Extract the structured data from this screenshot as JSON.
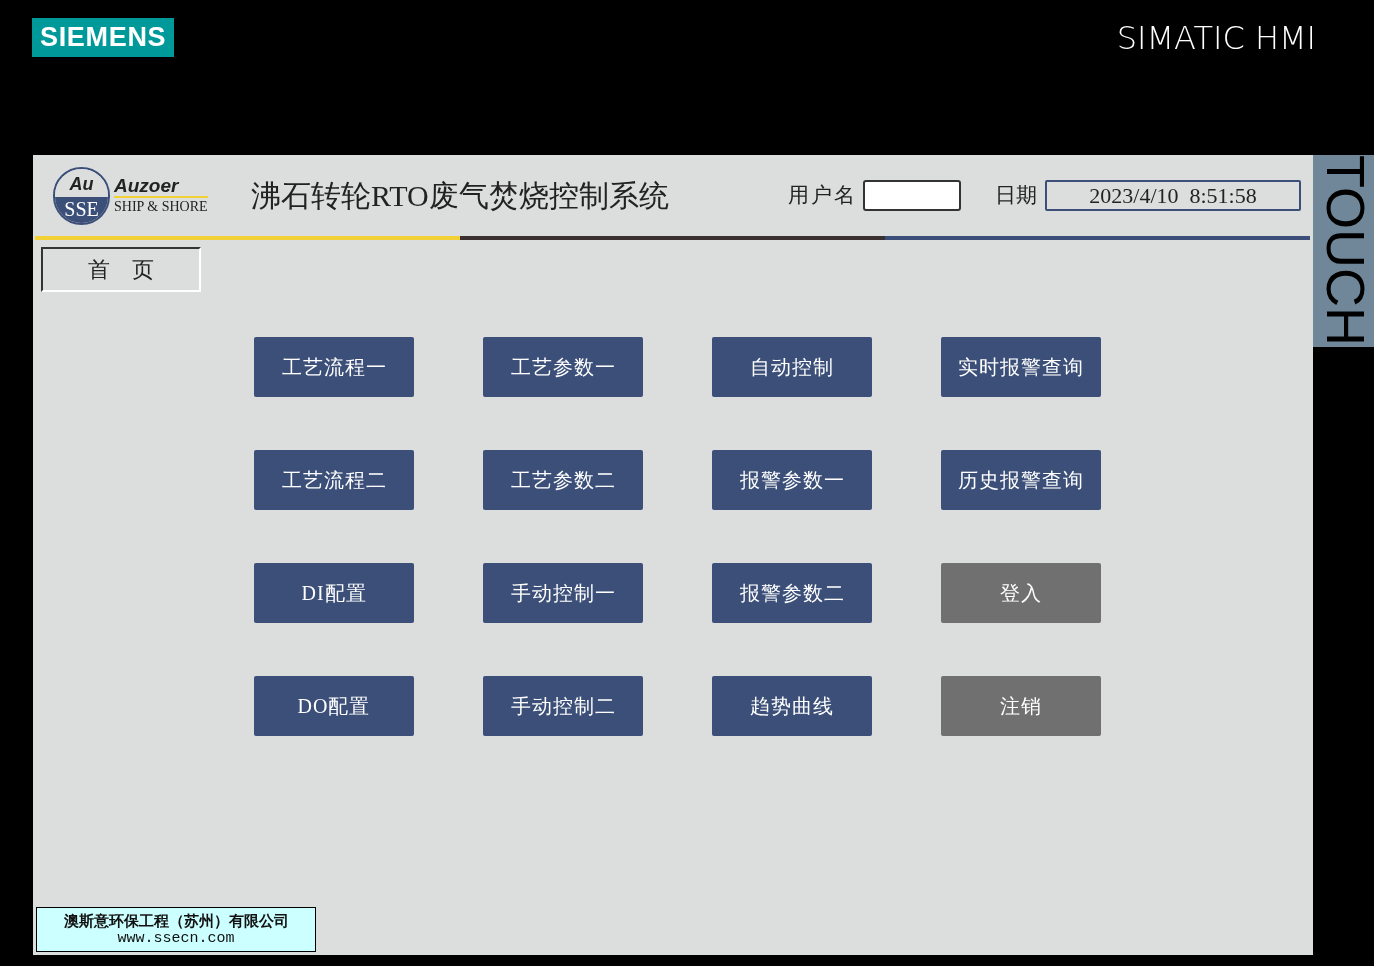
{
  "brand": {
    "logo": "SIEMENS",
    "product": "SIMATIC HMI",
    "side_label": "TOUCH"
  },
  "header": {
    "logo_mark_top": "Au",
    "logo_mark_bottom": "SSE",
    "logo_word": "Auzoer",
    "logo_tagline": "SHIP & SHORE",
    "title": "沸石转轮RTO废气焚烧控制系统",
    "user_label": "用户名",
    "date_label": "日期",
    "date_value": "2023/4/10  8:51:58"
  },
  "tabs": [
    {
      "label": "首　页",
      "selected": true
    }
  ],
  "buttons": [
    {
      "label": "工艺流程一",
      "kind": "nav"
    },
    {
      "label": "工艺参数一",
      "kind": "nav"
    },
    {
      "label": "自动控制",
      "kind": "nav"
    },
    {
      "label": "实时报警查询",
      "kind": "nav"
    },
    {
      "label": "工艺流程二",
      "kind": "nav"
    },
    {
      "label": "工艺参数二",
      "kind": "nav"
    },
    {
      "label": "报警参数一",
      "kind": "nav"
    },
    {
      "label": "历史报警查询",
      "kind": "nav"
    },
    {
      "label": "DI配置",
      "kind": "nav"
    },
    {
      "label": "手动控制一",
      "kind": "nav"
    },
    {
      "label": "报警参数二",
      "kind": "nav"
    },
    {
      "label": "登入",
      "kind": "account"
    },
    {
      "label": "DO配置",
      "kind": "nav"
    },
    {
      "label": "手动控制二",
      "kind": "nav"
    },
    {
      "label": "趋势曲线",
      "kind": "nav"
    },
    {
      "label": "注销",
      "kind": "account"
    }
  ],
  "footer": {
    "company": "澳斯意环保工程（苏州）有限公司",
    "website": "www.ssecn.com"
  }
}
